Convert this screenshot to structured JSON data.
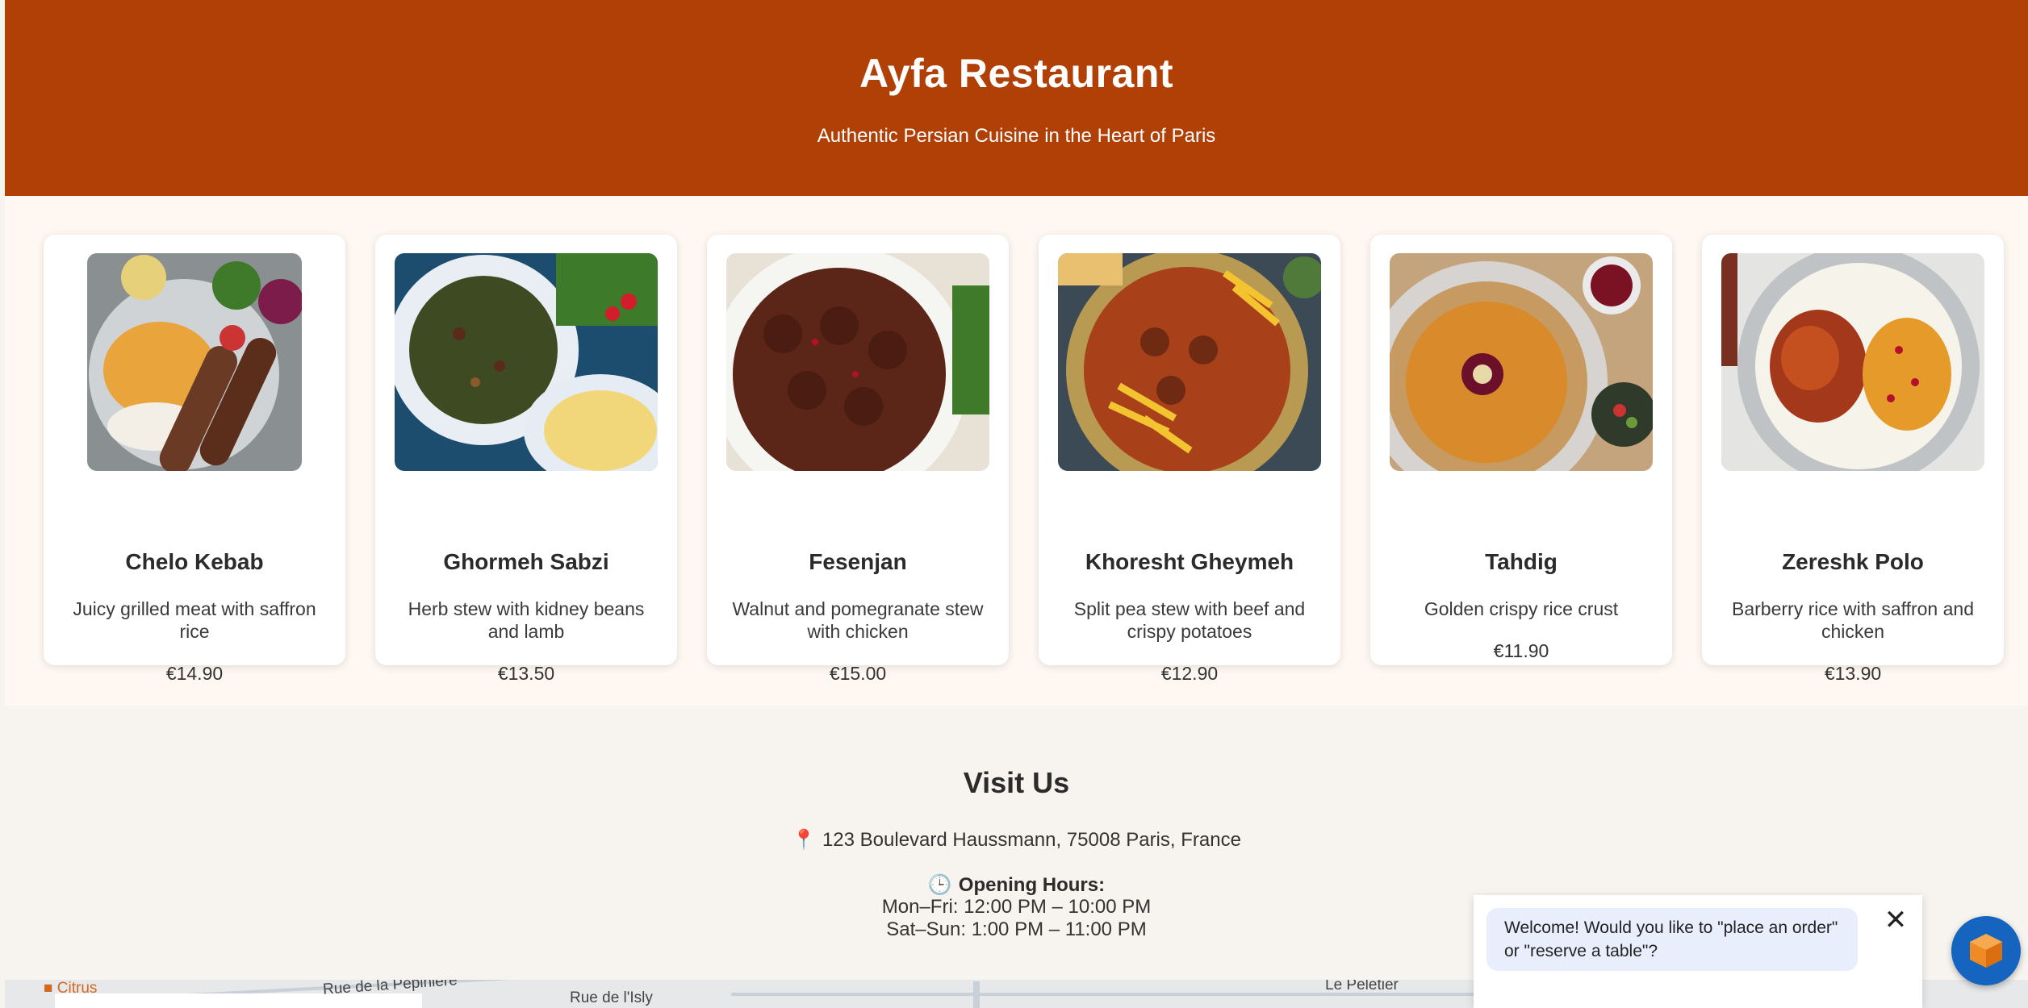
{
  "header": {
    "title": "Ayfa Restaurant",
    "subtitle": "Authentic Persian Cuisine in the Heart of Paris"
  },
  "menu": {
    "items": [
      {
        "name": "Chelo Kebab",
        "description": "Juicy grilled meat with saffron rice",
        "price": "€14.90",
        "image_icon": "chelo-kebab-image"
      },
      {
        "name": "Ghormeh Sabzi",
        "description": "Herb stew with kidney beans and lamb",
        "price": "€13.50",
        "image_icon": "ghormeh-sabzi-image"
      },
      {
        "name": "Fesenjan",
        "description": "Walnut and pomegranate stew with chicken",
        "price": "€15.00",
        "image_icon": "fesenjan-image"
      },
      {
        "name": "Khoresht Gheymeh",
        "description": "Split pea stew with beef and crispy potatoes",
        "price": "€12.90",
        "image_icon": "khoresht-gheymeh-image"
      },
      {
        "name": "Tahdig",
        "description": "Golden crispy rice crust",
        "price": "€11.90",
        "image_icon": "tahdig-image"
      },
      {
        "name": "Zereshk Polo",
        "description": "Barberry rice with saffron and chicken",
        "price": "€13.90",
        "image_icon": "zereshk-polo-image"
      }
    ]
  },
  "visit": {
    "title": "Visit Us",
    "address": "123 Boulevard Haussmann, 75008 Paris, France",
    "hours_title": "Opening Hours:",
    "hours": [
      "Mon–Fri: 12:00 PM – 10:00 PM",
      "Sat–Sun: 1:00 PM – 11:00 PM"
    ]
  },
  "map": {
    "labels": [
      "Rue de la Pépinière",
      "Rue de l'Isly",
      "Le Peletier",
      "Citrus"
    ]
  },
  "chat": {
    "message": "Welcome! Would you like to \"place an order\" or \"reserve a table\"?",
    "close_label": "✕"
  },
  "colors": {
    "header_bg": "#b04006",
    "menu_bg": "#fff8f2",
    "page_bg": "#f7f4ef",
    "chat_bubble": "#e8eefb",
    "launcher": "#1565c0",
    "launcher_cube": "#f08a24"
  }
}
